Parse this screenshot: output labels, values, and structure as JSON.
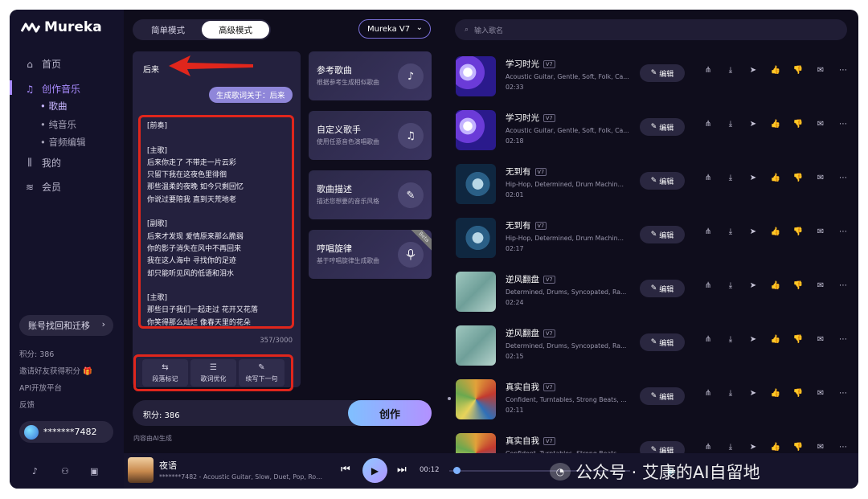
{
  "app": {
    "name": "Mureka"
  },
  "sidebar": {
    "items": [
      {
        "label": "首页",
        "icon": "home-icon"
      },
      {
        "label": "创作音乐",
        "icon": "music-note-icon"
      },
      {
        "label": "我的",
        "icon": "library-icon"
      },
      {
        "label": "会员",
        "icon": "coins-icon"
      }
    ],
    "sub_items": [
      {
        "label": "• 歌曲"
      },
      {
        "label": "• 纯音乐"
      },
      {
        "label": "• 音频编辑"
      }
    ],
    "account_button": "账号找回和迁移",
    "credits": "积分: 386",
    "invite": "邀请好友获得积分 🎁",
    "api": "API开放平台",
    "feedback": "反馈",
    "user": "*******7482"
  },
  "modes": {
    "simple": "简单模式",
    "advanced": "高级模式"
  },
  "model": {
    "selected": "Mureka V7"
  },
  "editor": {
    "song_title": "后来",
    "generate_chip": "生成歌词关于：后来",
    "lyrics": [
      "[前奏]",
      "",
      "[主歌]",
      "后来你走了 不带走一片云彩",
      "只留下我在这夜色里徘徊",
      "那些温柔的夜晚 如今只剩回忆",
      "你说过要陪我 直到天荒地老",
      "",
      "[副歌]",
      "后来才发现 爱情原来那么脆弱",
      "你的影子消失在风中不再回来",
      "我在这人海中 寻找你的足迹",
      "却只能听见风的低语和泪水",
      "",
      "[主歌]",
      "那些日子我们一起走过 花开又花落",
      "你笑得那么灿烂 像春天里的花朵"
    ],
    "char_count": "357/3000",
    "tools": [
      {
        "label": "段落标记",
        "icon": "paragraph-mark-icon",
        "glyph": "⇆"
      },
      {
        "label": "歌词优化",
        "icon": "optimize-icon",
        "glyph": "☰"
      },
      {
        "label": "续写下一句",
        "icon": "pen-icon",
        "glyph": "✎"
      }
    ]
  },
  "features": [
    {
      "title": "参考歌曲",
      "desc": "根据参考生成相似歌曲",
      "icon": "music-note-icon",
      "glyph": "♪",
      "beta": ""
    },
    {
      "title": "自定义歌手",
      "desc": "使用任意音色演唱歌曲",
      "icon": "singer-icon",
      "glyph": "♫",
      "beta": ""
    },
    {
      "title": "歌曲描述",
      "desc": "描述您想要的音乐风格",
      "icon": "edit-icon",
      "glyph": "✎",
      "beta": ""
    },
    {
      "title": "哼唱旋律",
      "desc": "基于哼唱旋律生成歌曲",
      "icon": "microphone-icon",
      "glyph": "♁",
      "beta": "Beta"
    }
  ],
  "create": {
    "credits_label": "积分:   386",
    "button": "创作",
    "ai_note": "内容由AI生成"
  },
  "search": {
    "placeholder": "输入歌名"
  },
  "songs": [
    {
      "title": "学习时光",
      "version": "V7",
      "tags": "Acoustic Guitar, Gentle, Soft, Folk, Ca...",
      "duration": "02:33",
      "edit": "编辑",
      "thumb": "purple-swirl"
    },
    {
      "title": "学习时光",
      "version": "V7",
      "tags": "Acoustic Guitar, Gentle, Soft, Folk, Ca...",
      "duration": "02:18",
      "edit": "编辑",
      "thumb": "purple-swirl"
    },
    {
      "title": "无到有",
      "version": "V7",
      "tags": "Hip-Hop, Determined, Drum Machin...",
      "duration": "02:01",
      "edit": "编辑",
      "thumb": "blue-wave"
    },
    {
      "title": "无到有",
      "version": "V7",
      "tags": "Hip-Hop, Determined, Drum Machin...",
      "duration": "02:17",
      "edit": "编辑",
      "thumb": "blue-wave"
    },
    {
      "title": "逆风翻盘",
      "version": "V7",
      "tags": "Determined, Drums, Syncopated, Ra...",
      "duration": "02:24",
      "edit": "编辑",
      "thumb": "teal-marble"
    },
    {
      "title": "逆风翻盘",
      "version": "V7",
      "tags": "Determined, Drums, Syncopated, Ra...",
      "duration": "02:15",
      "edit": "编辑",
      "thumb": "teal-marble"
    },
    {
      "title": "真实自我",
      "version": "V7",
      "tags": "Confident, Turntables, Strong Beats, ...",
      "duration": "02:11",
      "edit": "编辑",
      "thumb": "colorful-art"
    },
    {
      "title": "真实自我",
      "version": "V7",
      "tags": "Confident, Turntables, Strong Beats, ...",
      "duration": "",
      "edit": "编辑",
      "thumb": "colorful-art"
    }
  ],
  "player": {
    "title": "夜语",
    "subtitle": "*******7482 - Acoustic Guitar, Slow, Duet, Pop, Rom...",
    "time": "00:12",
    "progress": 0.02
  },
  "watermark": {
    "text": "公众号 · 艾康的AI自留地"
  },
  "colors": {
    "accent": "#a98bff",
    "highlight_border": "#e0261c",
    "background": "#0f0d1c"
  }
}
